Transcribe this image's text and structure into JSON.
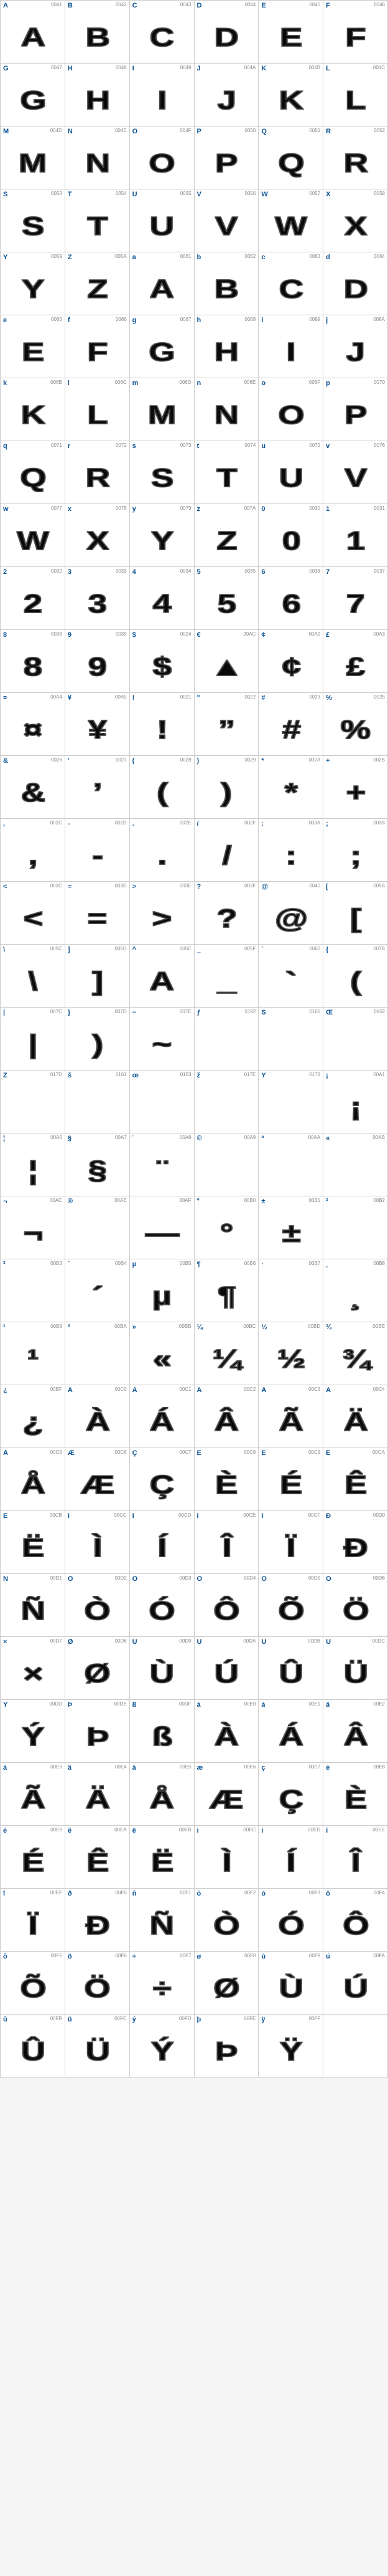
{
  "cells": [
    {
      "label": "A",
      "code": "0041",
      "glyph": "A"
    },
    {
      "label": "B",
      "code": "0042",
      "glyph": "B"
    },
    {
      "label": "C",
      "code": "0043",
      "glyph": "C"
    },
    {
      "label": "D",
      "code": "0044",
      "glyph": "D"
    },
    {
      "label": "E",
      "code": "0045",
      "glyph": "E"
    },
    {
      "label": "F",
      "code": "0046",
      "glyph": "F"
    },
    {
      "label": "G",
      "code": "0047",
      "glyph": "G"
    },
    {
      "label": "H",
      "code": "0048",
      "glyph": "H"
    },
    {
      "label": "I",
      "code": "0049",
      "glyph": "I"
    },
    {
      "label": "J",
      "code": "004A",
      "glyph": "J"
    },
    {
      "label": "K",
      "code": "004B",
      "glyph": "K"
    },
    {
      "label": "L",
      "code": "004C",
      "glyph": "L"
    },
    {
      "label": "M",
      "code": "004D",
      "glyph": "M"
    },
    {
      "label": "N",
      "code": "004E",
      "glyph": "N"
    },
    {
      "label": "O",
      "code": "004F",
      "glyph": "O"
    },
    {
      "label": "P",
      "code": "0050",
      "glyph": "P"
    },
    {
      "label": "Q",
      "code": "0051",
      "glyph": "Q"
    },
    {
      "label": "R",
      "code": "0052",
      "glyph": "R"
    },
    {
      "label": "S",
      "code": "0053",
      "glyph": "S"
    },
    {
      "label": "T",
      "code": "0054",
      "glyph": "T"
    },
    {
      "label": "U",
      "code": "0055",
      "glyph": "U"
    },
    {
      "label": "V",
      "code": "0056",
      "glyph": "V"
    },
    {
      "label": "W",
      "code": "0057",
      "glyph": "W"
    },
    {
      "label": "X",
      "code": "0058",
      "glyph": "X"
    },
    {
      "label": "Y",
      "code": "0059",
      "glyph": "Y"
    },
    {
      "label": "Z",
      "code": "005A",
      "glyph": "Z"
    },
    {
      "label": "a",
      "code": "0061",
      "glyph": "A"
    },
    {
      "label": "b",
      "code": "0062",
      "glyph": "B"
    },
    {
      "label": "c",
      "code": "0063",
      "glyph": "C"
    },
    {
      "label": "d",
      "code": "0064",
      "glyph": "D"
    },
    {
      "label": "e",
      "code": "0065",
      "glyph": "E"
    },
    {
      "label": "f",
      "code": "0066",
      "glyph": "F"
    },
    {
      "label": "g",
      "code": "0067",
      "glyph": "G"
    },
    {
      "label": "h",
      "code": "0068",
      "glyph": "H"
    },
    {
      "label": "i",
      "code": "0069",
      "glyph": "I"
    },
    {
      "label": "j",
      "code": "006A",
      "glyph": "J"
    },
    {
      "label": "k",
      "code": "006B",
      "glyph": "K"
    },
    {
      "label": "l",
      "code": "006C",
      "glyph": "L"
    },
    {
      "label": "m",
      "code": "006D",
      "glyph": "M"
    },
    {
      "label": "n",
      "code": "006E",
      "glyph": "N"
    },
    {
      "label": "o",
      "code": "006F",
      "glyph": "O"
    },
    {
      "label": "p",
      "code": "0070",
      "glyph": "P"
    },
    {
      "label": "q",
      "code": "0071",
      "glyph": "Q"
    },
    {
      "label": "r",
      "code": "0072",
      "glyph": "R"
    },
    {
      "label": "s",
      "code": "0073",
      "glyph": "S"
    },
    {
      "label": "t",
      "code": "0074",
      "glyph": "T"
    },
    {
      "label": "u",
      "code": "0075",
      "glyph": "U"
    },
    {
      "label": "v",
      "code": "0076",
      "glyph": "V"
    },
    {
      "label": "w",
      "code": "0077",
      "glyph": "W"
    },
    {
      "label": "x",
      "code": "0078",
      "glyph": "X"
    },
    {
      "label": "y",
      "code": "0079",
      "glyph": "Y"
    },
    {
      "label": "z",
      "code": "007A",
      "glyph": "Z"
    },
    {
      "label": "0",
      "code": "0030",
      "glyph": "0"
    },
    {
      "label": "1",
      "code": "0031",
      "glyph": "1"
    },
    {
      "label": "2",
      "code": "0032",
      "glyph": "2"
    },
    {
      "label": "3",
      "code": "0033",
      "glyph": "3"
    },
    {
      "label": "4",
      "code": "0034",
      "glyph": "4"
    },
    {
      "label": "5",
      "code": "0035",
      "glyph": "5"
    },
    {
      "label": "6",
      "code": "0036",
      "glyph": "6"
    },
    {
      "label": "7",
      "code": "0037",
      "glyph": "7"
    },
    {
      "label": "8",
      "code": "0038",
      "glyph": "8"
    },
    {
      "label": "9",
      "code": "0039",
      "glyph": "9"
    },
    {
      "label": "$",
      "code": "0024",
      "glyph": "$"
    },
    {
      "label": "€",
      "code": "20AC",
      "glyph": "▲"
    },
    {
      "label": "¢",
      "code": "00A2",
      "glyph": "¢"
    },
    {
      "label": "£",
      "code": "00A3",
      "glyph": "£"
    },
    {
      "label": "¤",
      "code": "00A4",
      "glyph": "¤"
    },
    {
      "label": "¥",
      "code": "00A5",
      "glyph": "¥"
    },
    {
      "label": "!",
      "code": "0021",
      "glyph": "!"
    },
    {
      "label": "\"",
      "code": "0022",
      "glyph": "”"
    },
    {
      "label": "#",
      "code": "0023",
      "glyph": "#"
    },
    {
      "label": "%",
      "code": "0025",
      "glyph": "%"
    },
    {
      "label": "&",
      "code": "0026",
      "glyph": "&"
    },
    {
      "label": "'",
      "code": "0027",
      "glyph": "’"
    },
    {
      "label": "(",
      "code": "0028",
      "glyph": "("
    },
    {
      "label": ")",
      "code": "0029",
      "glyph": ")"
    },
    {
      "label": "*",
      "code": "002A",
      "glyph": "*"
    },
    {
      "label": "+",
      "code": "002B",
      "glyph": "+"
    },
    {
      "label": ",",
      "code": "002C",
      "glyph": ","
    },
    {
      "label": "-",
      "code": "002D",
      "glyph": "-"
    },
    {
      "label": ".",
      "code": "002E",
      "glyph": "."
    },
    {
      "label": "/",
      "code": "002F",
      "glyph": "/"
    },
    {
      "label": ":",
      "code": "003A",
      "glyph": ":"
    },
    {
      "label": ";",
      "code": "003B",
      "glyph": ";"
    },
    {
      "label": "<",
      "code": "003C",
      "glyph": "<"
    },
    {
      "label": "=",
      "code": "003D",
      "glyph": "="
    },
    {
      "label": ">",
      "code": "003E",
      "glyph": ">"
    },
    {
      "label": "?",
      "code": "003F",
      "glyph": "?"
    },
    {
      "label": "@",
      "code": "0040",
      "glyph": "@"
    },
    {
      "label": "[",
      "code": "005B",
      "glyph": "["
    },
    {
      "label": "\\",
      "code": "005C",
      "glyph": "\\"
    },
    {
      "label": "]",
      "code": "005D",
      "glyph": "]"
    },
    {
      "label": "^",
      "code": "005E",
      "glyph": "A"
    },
    {
      "label": "_",
      "code": "005F",
      "glyph": "_"
    },
    {
      "label": "`",
      "code": "0060",
      "glyph": "`"
    },
    {
      "label": "{",
      "code": "007B",
      "glyph": "("
    },
    {
      "label": "|",
      "code": "007C",
      "glyph": "|"
    },
    {
      "label": "}",
      "code": "007D",
      "glyph": ")"
    },
    {
      "label": "~",
      "code": "007E",
      "glyph": "~"
    },
    {
      "label": "ƒ",
      "code": "0192",
      "glyph": ""
    },
    {
      "label": "Š",
      "code": "0160",
      "glyph": ""
    },
    {
      "label": "Œ",
      "code": "0152",
      "glyph": ""
    },
    {
      "label": "Ž",
      "code": "017D",
      "glyph": ""
    },
    {
      "label": "š",
      "code": "0161",
      "glyph": ""
    },
    {
      "label": "œ",
      "code": "0153",
      "glyph": ""
    },
    {
      "label": "ž",
      "code": "017E",
      "glyph": ""
    },
    {
      "label": "Ÿ",
      "code": "0178",
      "glyph": ""
    },
    {
      "label": "¡",
      "code": "00A1",
      "glyph": "¡"
    },
    {
      "label": "¦",
      "code": "00A6",
      "glyph": "¦"
    },
    {
      "label": "§",
      "code": "00A7",
      "glyph": "§"
    },
    {
      "label": "¨",
      "code": "00A8",
      "glyph": "¨"
    },
    {
      "label": "©",
      "code": "00A9",
      "glyph": ""
    },
    {
      "label": "ª",
      "code": "00AA",
      "glyph": ""
    },
    {
      "label": "«",
      "code": "00AB",
      "glyph": ""
    },
    {
      "label": "¬",
      "code": "00AC",
      "glyph": "¬"
    },
    {
      "label": "®",
      "code": "00AE",
      "glyph": ""
    },
    {
      "label": "¯",
      "code": "00AF",
      "glyph": "—"
    },
    {
      "label": "°",
      "code": "00B0",
      "glyph": "°"
    },
    {
      "label": "±",
      "code": "00B1",
      "glyph": "±"
    },
    {
      "label": "²",
      "code": "00B2",
      "glyph": ""
    },
    {
      "label": "³",
      "code": "00B3",
      "glyph": ""
    },
    {
      "label": "´",
      "code": "00B4",
      "glyph": "´"
    },
    {
      "label": "µ",
      "code": "00B5",
      "glyph": "µ"
    },
    {
      "label": "¶",
      "code": "00B6",
      "glyph": "¶"
    },
    {
      "label": "·",
      "code": "00B7",
      "glyph": ""
    },
    {
      "label": "¸",
      "code": "00B8",
      "glyph": "¸"
    },
    {
      "label": "¹",
      "code": "00B9",
      "glyph": "¹"
    },
    {
      "label": "º",
      "code": "00BA",
      "glyph": ""
    },
    {
      "label": "»",
      "code": "00BB",
      "glyph": "«"
    },
    {
      "label": "¼",
      "code": "00BC",
      "glyph": "¼"
    },
    {
      "label": "½",
      "code": "00BD",
      "glyph": "½"
    },
    {
      "label": "¾",
      "code": "00BE",
      "glyph": "¾"
    },
    {
      "label": "¿",
      "code": "00BF",
      "glyph": "¿"
    },
    {
      "label": "À",
      "code": "00C0",
      "glyph": "À"
    },
    {
      "label": "Á",
      "code": "00C1",
      "glyph": "Á"
    },
    {
      "label": "Â",
      "code": "00C2",
      "glyph": "Â"
    },
    {
      "label": "Ã",
      "code": "00C3",
      "glyph": "Ã"
    },
    {
      "label": "Ä",
      "code": "00C4",
      "glyph": "Ä"
    },
    {
      "label": "Å",
      "code": "00C5",
      "glyph": "Å"
    },
    {
      "label": "Æ",
      "code": "00C6",
      "glyph": "Æ"
    },
    {
      "label": "Ç",
      "code": "00C7",
      "glyph": "Ç"
    },
    {
      "label": "È",
      "code": "00C8",
      "glyph": "È"
    },
    {
      "label": "É",
      "code": "00C9",
      "glyph": "É"
    },
    {
      "label": "Ê",
      "code": "00CA",
      "glyph": "Ê"
    },
    {
      "label": "Ë",
      "code": "00CB",
      "glyph": "Ë"
    },
    {
      "label": "Ì",
      "code": "00CC",
      "glyph": "Ì"
    },
    {
      "label": "Í",
      "code": "00CD",
      "glyph": "Í"
    },
    {
      "label": "Î",
      "code": "00CE",
      "glyph": "Î"
    },
    {
      "label": "Ï",
      "code": "00CF",
      "glyph": "Ï"
    },
    {
      "label": "Ð",
      "code": "00D0",
      "glyph": "Ð"
    },
    {
      "label": "Ñ",
      "code": "00D1",
      "glyph": "Ñ"
    },
    {
      "label": "Ò",
      "code": "00D2",
      "glyph": "Ò"
    },
    {
      "label": "Ó",
      "code": "00D3",
      "glyph": "Ó"
    },
    {
      "label": "Ô",
      "code": "00D4",
      "glyph": "Ô"
    },
    {
      "label": "Õ",
      "code": "00D5",
      "glyph": "Õ"
    },
    {
      "label": "Ö",
      "code": "00D6",
      "glyph": "Ö"
    },
    {
      "label": "×",
      "code": "00D7",
      "glyph": "×"
    },
    {
      "label": "Ø",
      "code": "00D8",
      "glyph": "Ø"
    },
    {
      "label": "Ù",
      "code": "00D9",
      "glyph": "Ù"
    },
    {
      "label": "Ú",
      "code": "00DA",
      "glyph": "Ú"
    },
    {
      "label": "Û",
      "code": "00DB",
      "glyph": "Û"
    },
    {
      "label": "Ü",
      "code": "00DC",
      "glyph": "Ü"
    },
    {
      "label": "Ý",
      "code": "00DD",
      "glyph": "Ý"
    },
    {
      "label": "Þ",
      "code": "00DE",
      "glyph": "Þ"
    },
    {
      "label": "ß",
      "code": "00DF",
      "glyph": "ß"
    },
    {
      "label": "à",
      "code": "00E0",
      "glyph": "À"
    },
    {
      "label": "á",
      "code": "00E1",
      "glyph": "Á"
    },
    {
      "label": "â",
      "code": "00E2",
      "glyph": "Â"
    },
    {
      "label": "ã",
      "code": "00E3",
      "glyph": "Ã"
    },
    {
      "label": "ä",
      "code": "00E4",
      "glyph": "Ä"
    },
    {
      "label": "å",
      "code": "00E5",
      "glyph": "Å"
    },
    {
      "label": "æ",
      "code": "00E6",
      "glyph": "Æ"
    },
    {
      "label": "ç",
      "code": "00E7",
      "glyph": "Ç"
    },
    {
      "label": "è",
      "code": "00E8",
      "glyph": "È"
    },
    {
      "label": "é",
      "code": "00E9",
      "glyph": "É"
    },
    {
      "label": "ê",
      "code": "00EA",
      "glyph": "Ê"
    },
    {
      "label": "ë",
      "code": "00EB",
      "glyph": "Ë"
    },
    {
      "label": "ì",
      "code": "00EC",
      "glyph": "Ì"
    },
    {
      "label": "í",
      "code": "00ED",
      "glyph": "Í"
    },
    {
      "label": "î",
      "code": "00EE",
      "glyph": "Î"
    },
    {
      "label": "ï",
      "code": "00EF",
      "glyph": "Ï"
    },
    {
      "label": "ð",
      "code": "00F0",
      "glyph": "Ð"
    },
    {
      "label": "ñ",
      "code": "00F1",
      "glyph": "Ñ"
    },
    {
      "label": "ò",
      "code": "00F2",
      "glyph": "Ò"
    },
    {
      "label": "ó",
      "code": "00F3",
      "glyph": "Ó"
    },
    {
      "label": "ô",
      "code": "00F4",
      "glyph": "Ô"
    },
    {
      "label": "õ",
      "code": "00F5",
      "glyph": "Õ"
    },
    {
      "label": "ö",
      "code": "00F6",
      "glyph": "Ö"
    },
    {
      "label": "÷",
      "code": "00F7",
      "glyph": "÷"
    },
    {
      "label": "ø",
      "code": "00F8",
      "glyph": "Ø"
    },
    {
      "label": "ù",
      "code": "00F9",
      "glyph": "Ù"
    },
    {
      "label": "ú",
      "code": "00FA",
      "glyph": "Ú"
    },
    {
      "label": "û",
      "code": "00FB",
      "glyph": "Û"
    },
    {
      "label": "ü",
      "code": "00FC",
      "glyph": "Ü"
    },
    {
      "label": "ý",
      "code": "00FD",
      "glyph": "Ý"
    },
    {
      "label": "þ",
      "code": "00FE",
      "glyph": "Þ"
    },
    {
      "label": "ÿ",
      "code": "00FF",
      "glyph": "Ÿ"
    },
    {
      "label": "",
      "code": "",
      "glyph": ""
    }
  ]
}
